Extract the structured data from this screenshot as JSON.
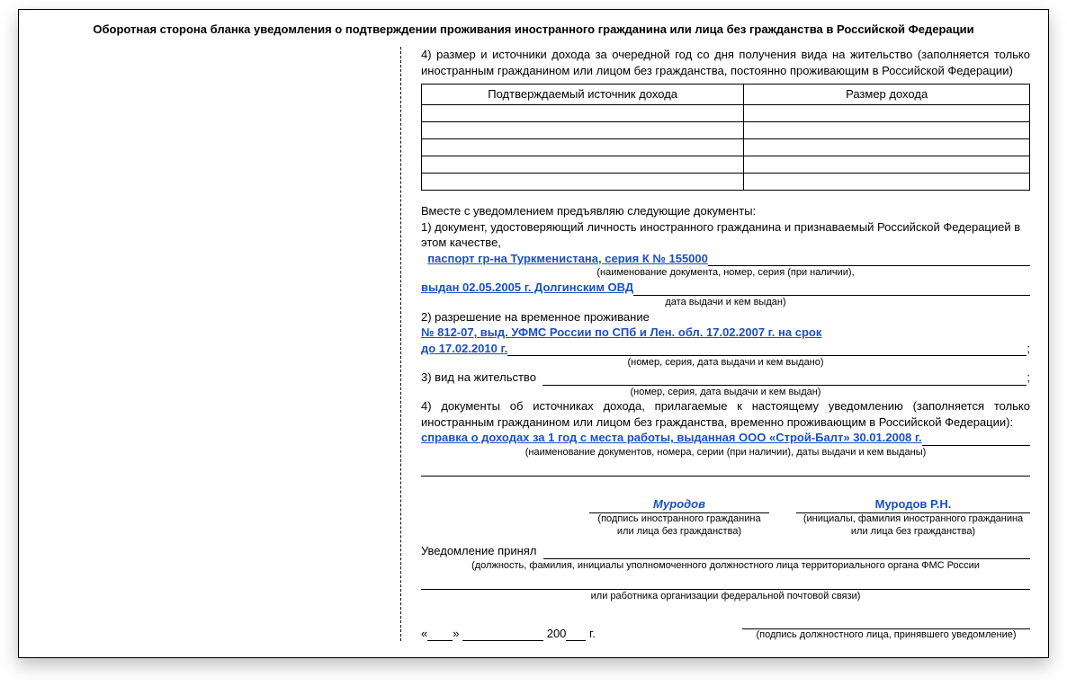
{
  "title": "Оборотная сторона бланка уведомления о подтверждении проживания иностранного гражданина или лица без гражданства в Российской Федерации",
  "section4_label": "4) размер и источники дохода за очередной год со дня получения вида на жительство (заполняется только иностранным гражданином или лицом без гражданства, постоянно проживающим в Российской Федерации)",
  "table": {
    "col1": "Подтверждаемый источник дохода",
    "col2": "Размер дохода"
  },
  "docs_intro": "Вместе с уведомлением предъявляю следующие документы:",
  "doc1_label": "1) документ, удостоверяющий личность иностранного гражданина и признаваемый Российской Федерацией в этом качестве,",
  "doc1_value": "паспорт гр-на Туркменистана, серия К № 155000",
  "doc1_hint": "(наименование документа, номер, серия (при наличии),",
  "doc1_line2": "выдан  02.05.2005 г. Долгинским ОВД",
  "doc1_hint2": "дата выдачи и кем выдан)",
  "doc2_label": "2) разрешение на временное проживание",
  "doc2_value": "№ 812-07, выд. УФМС России по СПб и Лен. обл. 17.02.2007 г. на срок до 17.02.2010 г.",
  "doc2_hint": "(номер, серия, дата выдачи и кем выдано)",
  "doc3_label": "3) вид на жительство",
  "doc3_hint": "(номер, серия, дата выдачи и кем выдан)",
  "doc4_label": "4) документы об источниках дохода, прилагаемые к настоящему уведомлению (заполняется только иностранным гражданином или лицом без гражданства, временно проживающим в Российской Федерации):",
  "doc4_value": "справка о доходах за 1 год с места работы, выданная ООО «Строй-Балт» 30.01.2008 г.",
  "doc4_hint": "(наименование документов, номера, серии (при наличии), даты выдачи и кем выданы)",
  "sig_applicant": "Муродов",
  "sig_applicant_cap": "(подпись иностранного гражданина\nили лица без гражданства)",
  "sig_name": "Муродов Р.Н.",
  "sig_name_cap": "(инициалы, фамилия иностранного гражданина\nили лица без гражданства)",
  "accepted_label": "Уведомление принял",
  "accepted_hint": "(должность, фамилия, инициалы уполномоченного должностного лица территориального органа ФМС России",
  "accepted_hint2": "или работника организации федеральной почтовой связи)",
  "date_prefix": "«",
  "date_mid": "»",
  "date_year_prefix": "200",
  "date_year_suffix": "г.",
  "official_sig_hint": "(подпись должностного лица, принявшего уведомление)"
}
